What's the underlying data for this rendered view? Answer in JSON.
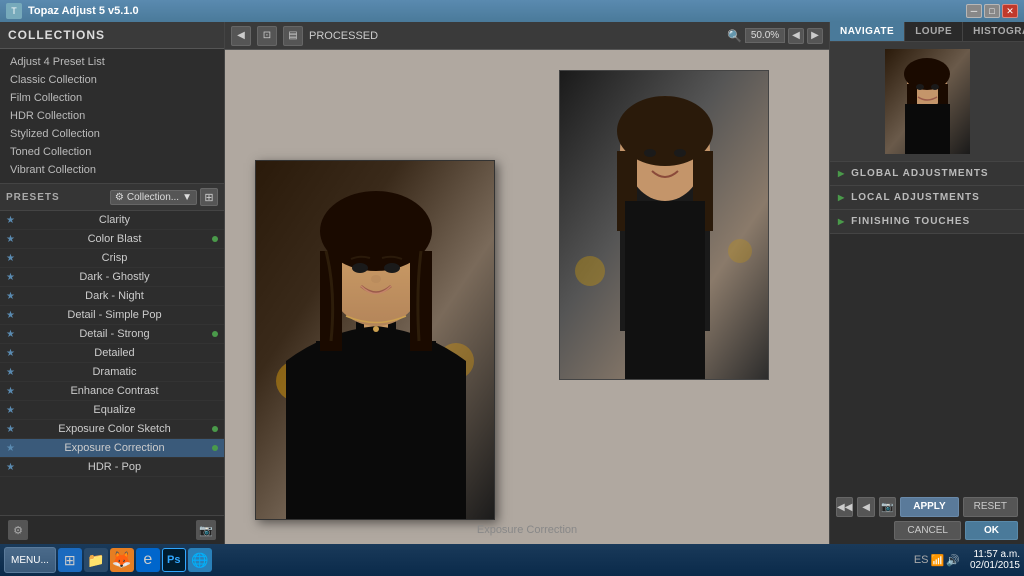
{
  "titlebar": {
    "title": "Topaz Adjust 5 v5.1.0",
    "icon": "T"
  },
  "collections": {
    "header": "COLLECTIONS",
    "items": [
      {
        "label": "Adjust 4 Preset List"
      },
      {
        "label": "Classic Collection"
      },
      {
        "label": "Film Collection"
      },
      {
        "label": "HDR Collection"
      },
      {
        "label": "Stylized Collection"
      },
      {
        "label": "Toned Collection"
      },
      {
        "label": "Vibrant Collection"
      }
    ]
  },
  "presets": {
    "label": "PRESETS",
    "collection_btn": "Collection...",
    "items": [
      {
        "name": "Clarity",
        "starred": true,
        "dot": false
      },
      {
        "name": "Color Blast",
        "starred": true,
        "dot": true
      },
      {
        "name": "Crisp",
        "starred": true,
        "dot": false
      },
      {
        "name": "Dark - Ghostly",
        "starred": true,
        "dot": false
      },
      {
        "name": "Dark - Night",
        "starred": true,
        "dot": false
      },
      {
        "name": "Detail - Simple Pop",
        "starred": true,
        "dot": false
      },
      {
        "name": "Detail - Strong",
        "starred": true,
        "dot": true
      },
      {
        "name": "Detailed",
        "starred": true,
        "dot": false
      },
      {
        "name": "Dramatic",
        "starred": true,
        "dot": false
      },
      {
        "name": "Enhance Contrast",
        "starred": true,
        "dot": false
      },
      {
        "name": "Equalize",
        "starred": true,
        "dot": false
      },
      {
        "name": "Exposure Color Sketch",
        "starred": true,
        "dot": true
      },
      {
        "name": "Exposure Correction",
        "starred": true,
        "dot": true,
        "active": true
      },
      {
        "name": "HDR - Pop",
        "starred": true,
        "dot": false
      }
    ]
  },
  "toolbar": {
    "processed_label": "PROCESSED",
    "zoom_value": "50.0%"
  },
  "caption": "Exposure Correction",
  "nav_tabs": [
    {
      "label": "NAVIGATE",
      "active": true
    },
    {
      "label": "LOUPE",
      "active": false
    },
    {
      "label": "HISTOGRAM",
      "active": false
    }
  ],
  "adjustments": [
    {
      "label": "GLOBAL ADJUSTMENTS"
    },
    {
      "label": "LOCAL ADJUSTMENTS"
    },
    {
      "label": "FINISHING TOUCHES"
    }
  ],
  "buttons": {
    "apply": "APPLY",
    "reset": "RESET",
    "cancel": "CANCEL",
    "ok": "OK",
    "menu": "MENU..."
  },
  "taskbar": {
    "clock_time": "11:57 a.m.",
    "clock_date": "02/01/2015",
    "lang": "ES"
  }
}
